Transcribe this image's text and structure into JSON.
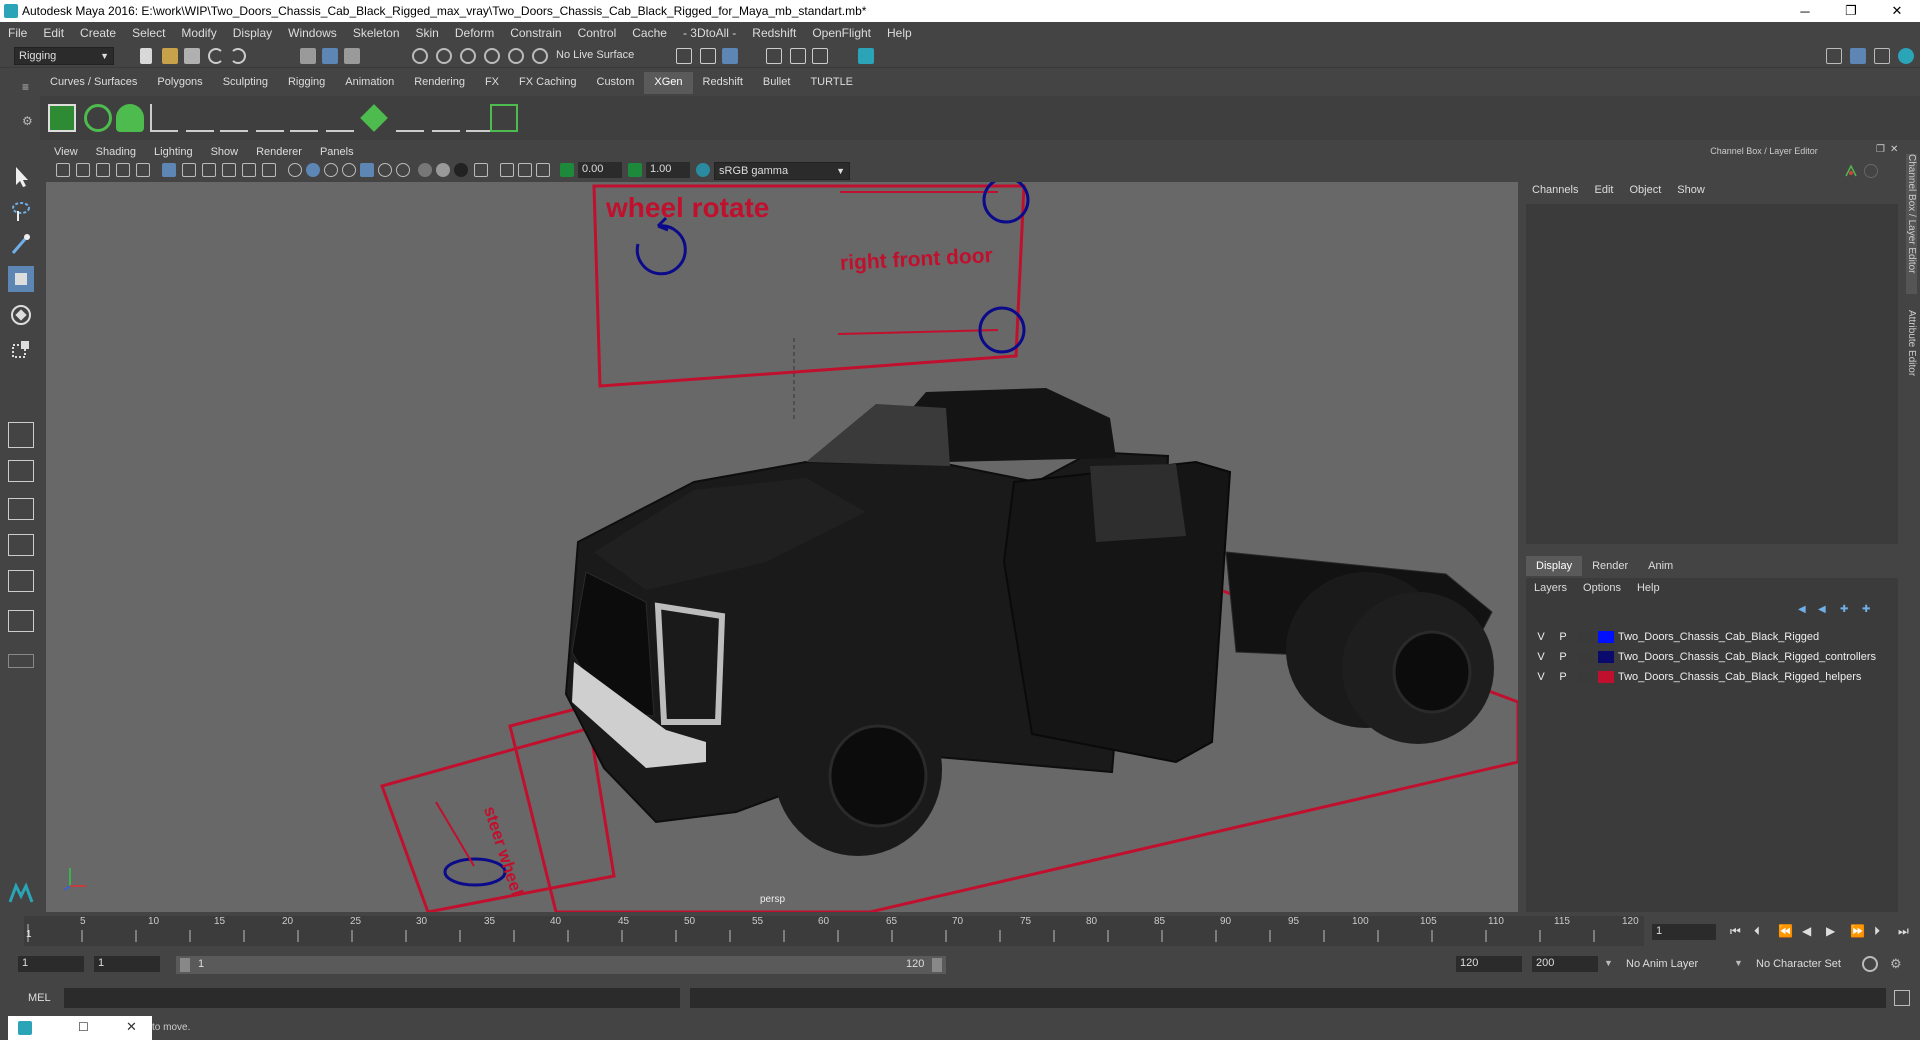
{
  "window": {
    "title": "Autodesk Maya 2016: E:\\work\\WIP\\Two_Doors_Chassis_Cab_Black_Rigged_max_vray\\Two_Doors_Chassis_Cab_Black_Rigged_for_Maya_mb_standart.mb*",
    "minimize": "─",
    "restore": "❐",
    "close": "✕"
  },
  "menubar": [
    "File",
    "Edit",
    "Create",
    "Select",
    "Modify",
    "Display",
    "Windows",
    "Skeleton",
    "Skin",
    "Deform",
    "Constrain",
    "Control",
    "Cache",
    "- 3DtoAll -",
    "Redshift",
    "OpenFlight",
    "Help"
  ],
  "statusline": {
    "mode": "Rigging",
    "live_surface": "No Live Surface"
  },
  "shelf_tabs": [
    "Curves / Surfaces",
    "Polygons",
    "Sculpting",
    "Rigging",
    "Animation",
    "Rendering",
    "FX",
    "FX Caching",
    "Custom",
    "XGen",
    "Redshift",
    "Bullet",
    "TURTLE"
  ],
  "shelf_active": "XGen",
  "viewport": {
    "menus": [
      "View",
      "Shading",
      "Lighting",
      "Show",
      "Renderer",
      "Panels"
    ],
    "exposure": "0.00",
    "gamma": "1.00",
    "colorspace": "sRGB gamma",
    "camera_label": "persp",
    "annotations": {
      "wheel_rotate": "wheel rotate",
      "right_front_door": "right front door",
      "steer": "steer wheel"
    }
  },
  "channel_box": {
    "title": "Channel Box / Layer Editor",
    "menus": [
      "Channels",
      "Edit",
      "Object",
      "Show"
    ]
  },
  "side_tabs": [
    "Channel Box / Layer Editor",
    "Attribute Editor"
  ],
  "layer_editor": {
    "tabs": [
      "Display",
      "Render",
      "Anim"
    ],
    "active_tab": "Display",
    "menus": [
      "Layers",
      "Options",
      "Help"
    ],
    "layers": [
      {
        "v": "V",
        "p": "P",
        "color": "#0010ff",
        "name": "Two_Doors_Chassis_Cab_Black_Rigged"
      },
      {
        "v": "V",
        "p": "P",
        "color": "#0a0a6e",
        "name": "Two_Doors_Chassis_Cab_Black_Rigged_controllers"
      },
      {
        "v": "V",
        "p": "P",
        "color": "#c0102e",
        "name": "Two_Doors_Chassis_Cab_Black_Rigged_helpers"
      }
    ]
  },
  "timeline": {
    "ticks": [
      "5",
      "10",
      "15",
      "20",
      "25",
      "30",
      "35",
      "40",
      "45",
      "50",
      "55",
      "60",
      "65",
      "70",
      "75",
      "80",
      "85",
      "90",
      "95",
      "100",
      "105",
      "110",
      "115",
      "120"
    ],
    "start_mark": "1",
    "current_frame": "1"
  },
  "range": {
    "start": "1",
    "playback_start": "1",
    "slider_start": "1",
    "slider_end": "120",
    "playback_end": "120",
    "end": "200",
    "anim_layer": "No Anim Layer",
    "character_set": "No Character Set"
  },
  "cmdline": {
    "label": "MEL"
  },
  "helpline": {
    "text": "to move."
  }
}
